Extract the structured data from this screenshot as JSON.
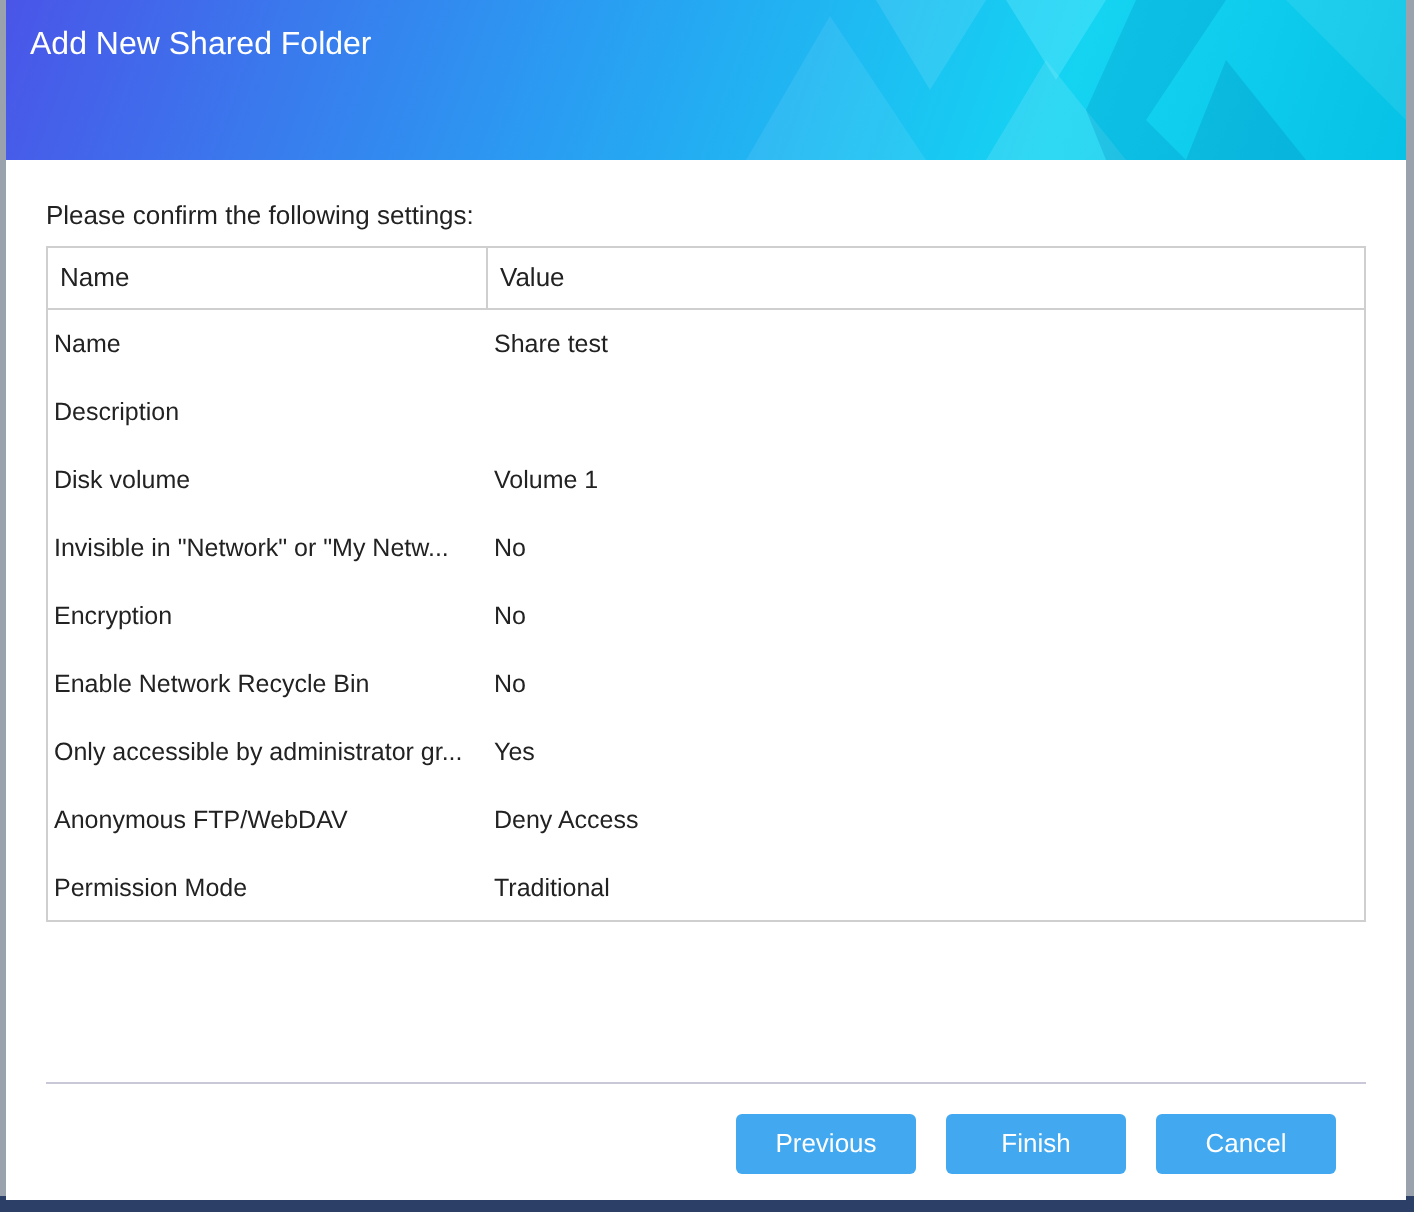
{
  "dialog": {
    "title": "Add New Shared Folder",
    "intro": "Please confirm the following settings:"
  },
  "table": {
    "columns": [
      "Name",
      "Value"
    ],
    "rows": [
      {
        "name": "Name",
        "value": "Share test"
      },
      {
        "name": "Description",
        "value": ""
      },
      {
        "name": "Disk volume",
        "value": "Volume 1"
      },
      {
        "name": "Invisible in \"Network\" or \"My Netw...",
        "value": "No"
      },
      {
        "name": "Encryption",
        "value": "No"
      },
      {
        "name": "Enable Network Recycle Bin",
        "value": "No"
      },
      {
        "name": "Only accessible by administrator gr...",
        "value": "Yes"
      },
      {
        "name": "Anonymous FTP/WebDAV",
        "value": "Deny Access"
      },
      {
        "name": "Permission Mode",
        "value": "Traditional"
      }
    ]
  },
  "buttons": [
    "Previous",
    "Finish",
    "Cancel"
  ]
}
